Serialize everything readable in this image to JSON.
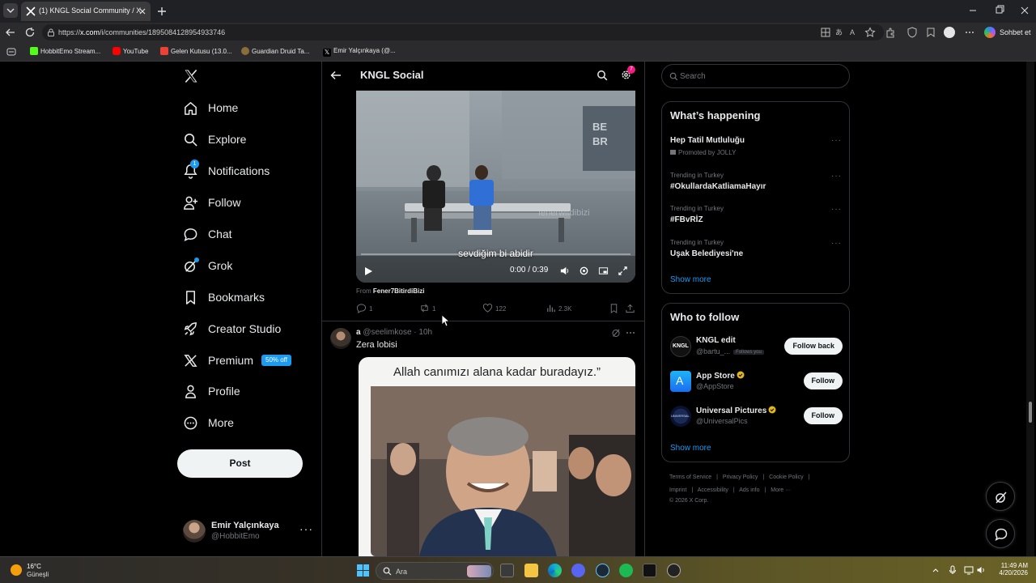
{
  "browser": {
    "tab_title": "(1) KNGL Social Community / X",
    "url_prefix": "https://",
    "url_host": "x.com",
    "url_path": "/i/communities/1895084128954933746",
    "chat_label": "Sohbet et",
    "bookmarks": [
      {
        "label": "HobbitEmo Stream...",
        "color": "#53fc18"
      },
      {
        "label": "YouTube",
        "color": "#ff0000"
      },
      {
        "label": "Gelen Kutusu (13.0...",
        "color": "#ea4335"
      },
      {
        "label": "Guardian Druid Ta...",
        "color": "#8a6d3b"
      },
      {
        "label": "Emir Yalçınkaya (@...",
        "color": "#000000"
      }
    ]
  },
  "nav": {
    "items": [
      {
        "label": "Home",
        "icon": "home-icon"
      },
      {
        "label": "Explore",
        "icon": "search-icon"
      },
      {
        "label": "Notifications",
        "icon": "bell-icon",
        "badge": "1"
      },
      {
        "label": "Follow",
        "icon": "person-add-icon"
      },
      {
        "label": "Chat",
        "icon": "chat-icon"
      },
      {
        "label": "Grok",
        "icon": "grok-icon"
      },
      {
        "label": "Bookmarks",
        "icon": "bookmark-icon"
      },
      {
        "label": "Creator Studio",
        "icon": "rocket-icon"
      },
      {
        "label": "Premium",
        "icon": "x-icon",
        "badge": "50% off"
      },
      {
        "label": "Profile",
        "icon": "person-icon"
      },
      {
        "label": "More",
        "icon": "more-circle-icon"
      }
    ],
    "post_label": "Post",
    "account": {
      "name": "Emir Yalçınkaya",
      "handle": "@HobbitEmo"
    }
  },
  "community": {
    "title": "KNGL Social",
    "settings_badge": "7"
  },
  "post1": {
    "video_caption": "sevdiğim bi abidir",
    "video_watermark": "fenerwitdibizi",
    "video_time": "0:00 / 0:39",
    "video_progress": 0.0,
    "from_label": "From",
    "from_account": "Fener7BitirdiBizi",
    "stats": {
      "replies": "1",
      "reposts": "1",
      "likes": "122",
      "views": "2.3K"
    }
  },
  "post2": {
    "name": "a",
    "handle": "@seelimkose",
    "time": "· 10h",
    "text": "Zera lobisi",
    "image_quote": "Allah canımızı alana kadar buradayız.”"
  },
  "sidebar": {
    "search_placeholder": "Search",
    "happening_title": "What’s happening",
    "trends": [
      {
        "context": "",
        "title": "Hep Tatil Mutluluğu",
        "sub": "Promoted by JOLLY"
      },
      {
        "context": "Trending in Turkey",
        "title": "#OkullardaKatliamaHayır"
      },
      {
        "context": "Trending in Turkey",
        "title": "#FBvRİZ"
      },
      {
        "context": "Trending in Turkey",
        "title": "Uşak Belediyesi'ne"
      }
    ],
    "show_more": "Show more",
    "wtf_title": "Who to follow",
    "wtf": [
      {
        "name": "KNGL edit",
        "handle": "@bartu_...",
        "follows_you": "Follows you",
        "button": "Follow back",
        "verified": false
      },
      {
        "name": "App Store",
        "handle": "@AppStore",
        "button": "Follow",
        "verified": true
      },
      {
        "name": "Universal Pictures",
        "handle": "@UniversalPics",
        "button": "Follow",
        "verified": true
      }
    ],
    "footer_line1": [
      "Terms of Service",
      "|",
      "Privacy Policy",
      "|",
      "Cookie Policy",
      "|"
    ],
    "footer_line2": [
      "Imprint",
      "|",
      "Accessibility",
      "|",
      "Ads info",
      "|",
      "More ···"
    ],
    "footer_line3": "© 2026 X Corp."
  },
  "taskbar": {
    "temp": "16°C",
    "condition": "Güneşli",
    "search_label": "Ara",
    "time": "11:49 AM",
    "date": "4/20/2026"
  }
}
